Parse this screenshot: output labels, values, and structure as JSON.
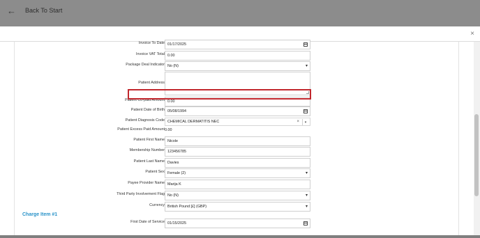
{
  "header": {
    "back_icon": "arrow-left-icon",
    "back_label": "Back To Start"
  },
  "modal": {
    "close_icon": "close-icon",
    "close_glyph": "×"
  },
  "form": {
    "invoice_to_date": {
      "label": "Invoice To Date",
      "value": "01/17/2025"
    },
    "invoice_vat_total": {
      "label": "Invoice VAT Total",
      "value": "0.00"
    },
    "package_deal_indicator": {
      "label": "Package Deal Indicator",
      "value": "No (N)"
    },
    "patient_address": {
      "label": "Patient Address",
      "value": ""
    },
    "patient_copaid_amount": {
      "label": "Patient Co-paid Amount",
      "value": "0.00"
    },
    "patient_date_of_birth": {
      "label": "Patient Date of Birth",
      "value": "05/08/1994"
    },
    "patient_diagnosis_code": {
      "label": "Patient Diagnosis Code",
      "value": "CHEMICAL DERMATITIS NEC",
      "clear": "×",
      "chevron": "▾"
    },
    "patient_excess_paid_amount": {
      "label": "Patient Excess Paid Amount",
      "value": "0.00"
    },
    "patient_first_name": {
      "label": "Patient First Name",
      "value": "Nicole"
    },
    "membership_number": {
      "label": "Membership Number",
      "value": "123456785"
    },
    "patient_last_name": {
      "label": "Patient Last Name",
      "value": "Davies"
    },
    "patient_sex": {
      "label": "Patient Sex",
      "value": "Female (2)"
    },
    "payee_provider_name": {
      "label": "Payee Provider Name",
      "value": "Marija  K"
    },
    "third_party_involvement_flag": {
      "label": "Third Party Involvement Flag",
      "value": "No (N)"
    },
    "currency": {
      "label": "Currency",
      "value": "British Pound [£] (GBP)"
    }
  },
  "charge_item": {
    "title": "Charge Item #1",
    "first_date_of_service": {
      "label": "First Date of Service",
      "value": "01/15/2025"
    }
  },
  "icons": {
    "select_chevron": "▾"
  },
  "colors": {
    "highlight": "#c1272d",
    "section_title": "#2a93c9",
    "overlay": "#8c8c8c"
  }
}
